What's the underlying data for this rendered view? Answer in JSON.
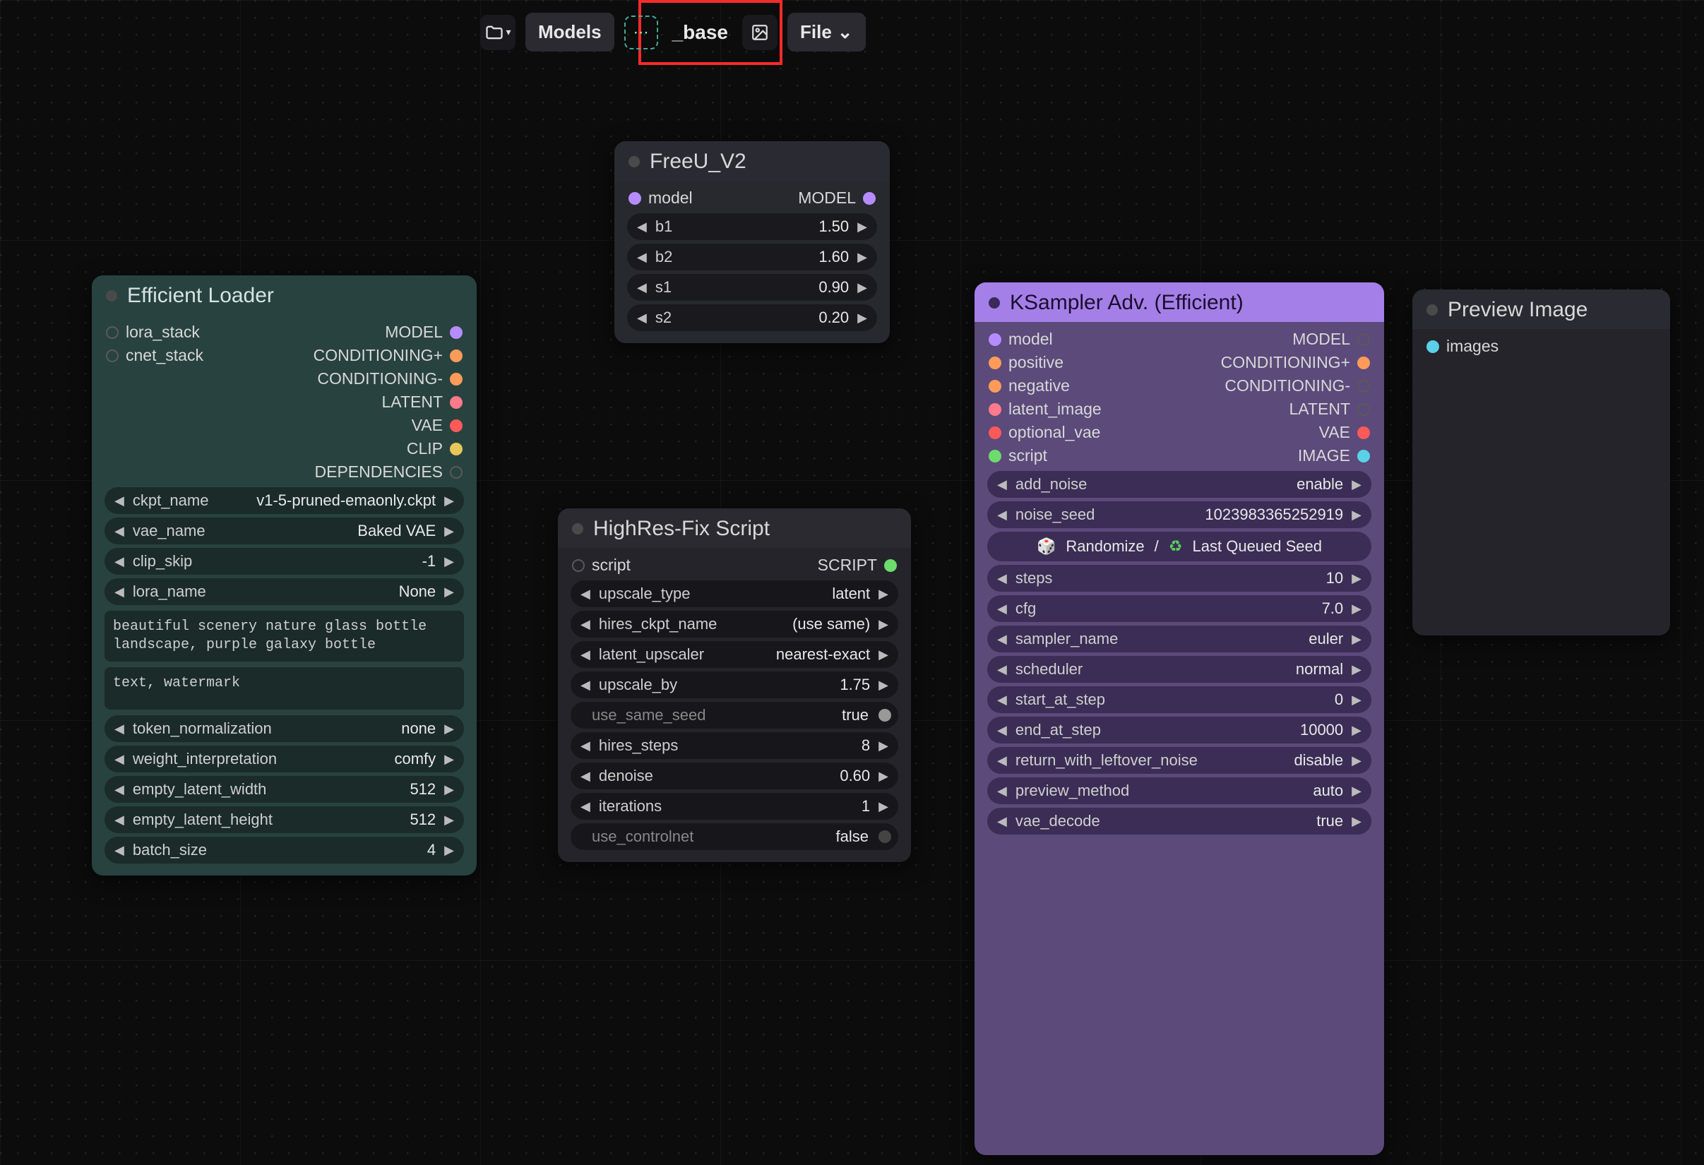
{
  "toolbar": {
    "models_label": "Models",
    "breadcrumb": "_base",
    "file_label": "File"
  },
  "nodes": {
    "efficient_loader": {
      "title": "Efficient Loader",
      "inputs": {
        "lora_stack": "lora_stack",
        "cnet_stack": "cnet_stack"
      },
      "outputs": {
        "model": "MODEL",
        "cond_pos": "CONDITIONING+",
        "cond_neg": "CONDITIONING-",
        "latent": "LATENT",
        "vae": "VAE",
        "clip": "CLIP",
        "deps": "DEPENDENCIES"
      },
      "widgets": {
        "ckpt_name": {
          "label": "ckpt_name",
          "value": "v1-5-pruned-emaonly.ckpt"
        },
        "vae_name": {
          "label": "vae_name",
          "value": "Baked VAE"
        },
        "clip_skip": {
          "label": "clip_skip",
          "value": "-1"
        },
        "lora_name": {
          "label": "lora_name",
          "value": "None"
        },
        "prompt_pos": "beautiful scenery nature glass bottle landscape, purple galaxy bottle",
        "prompt_neg": "text, watermark",
        "token_normalization": {
          "label": "token_normalization",
          "value": "none"
        },
        "weight_interpretation": {
          "label": "weight_interpretation",
          "value": "comfy"
        },
        "empty_latent_width": {
          "label": "empty_latent_width",
          "value": "512"
        },
        "empty_latent_height": {
          "label": "empty_latent_height",
          "value": "512"
        },
        "batch_size": {
          "label": "batch_size",
          "value": "4"
        }
      }
    },
    "freeu": {
      "title": "FreeU_V2",
      "inputs": {
        "model": "model"
      },
      "outputs": {
        "model": "MODEL"
      },
      "widgets": {
        "b1": {
          "label": "b1",
          "value": "1.50"
        },
        "b2": {
          "label": "b2",
          "value": "1.60"
        },
        "s1": {
          "label": "s1",
          "value": "0.90"
        },
        "s2": {
          "label": "s2",
          "value": "0.20"
        }
      }
    },
    "hires": {
      "title": "HighRes-Fix Script",
      "inputs": {
        "script": "script"
      },
      "outputs": {
        "script": "SCRIPT"
      },
      "widgets": {
        "upscale_type": {
          "label": "upscale_type",
          "value": "latent"
        },
        "hires_ckpt_name": {
          "label": "hires_ckpt_name",
          "value": "(use same)"
        },
        "latent_upscaler": {
          "label": "latent_upscaler",
          "value": "nearest-exact"
        },
        "upscale_by": {
          "label": "upscale_by",
          "value": "1.75"
        },
        "use_same_seed": {
          "label": "use_same_seed",
          "value": "true"
        },
        "hires_steps": {
          "label": "hires_steps",
          "value": "8"
        },
        "denoise": {
          "label": "denoise",
          "value": "0.60"
        },
        "iterations": {
          "label": "iterations",
          "value": "1"
        },
        "use_controlnet": {
          "label": "use_controlnet",
          "value": "false"
        }
      }
    },
    "ksampler": {
      "title": "KSampler Adv. (Efficient)",
      "inputs": {
        "model": "model",
        "positive": "positive",
        "negative": "negative",
        "latent_image": "latent_image",
        "optional_vae": "optional_vae",
        "script": "script"
      },
      "outputs": {
        "model": "MODEL",
        "cond_pos": "CONDITIONING+",
        "cond_neg": "CONDITIONING-",
        "latent": "LATENT",
        "vae": "VAE",
        "image": "IMAGE"
      },
      "widgets": {
        "add_noise": {
          "label": "add_noise",
          "value": "enable"
        },
        "noise_seed": {
          "label": "noise_seed",
          "value": "1023983365252919"
        },
        "seed_row": {
          "randomize": "Randomize",
          "slash": " / ",
          "last": "Last Queued Seed"
        },
        "steps": {
          "label": "steps",
          "value": "10"
        },
        "cfg": {
          "label": "cfg",
          "value": "7.0"
        },
        "sampler_name": {
          "label": "sampler_name",
          "value": "euler"
        },
        "scheduler": {
          "label": "scheduler",
          "value": "normal"
        },
        "start_at_step": {
          "label": "start_at_step",
          "value": "0"
        },
        "end_at_step": {
          "label": "end_at_step",
          "value": "10000"
        },
        "return_with_leftover_noise": {
          "label": "return_with_leftover_noise",
          "value": "disable"
        },
        "preview_method": {
          "label": "preview_method",
          "value": "auto"
        },
        "vae_decode": {
          "label": "vae_decode",
          "value": "true"
        }
      }
    },
    "preview": {
      "title": "Preview Image",
      "inputs": {
        "images": "images"
      }
    }
  }
}
